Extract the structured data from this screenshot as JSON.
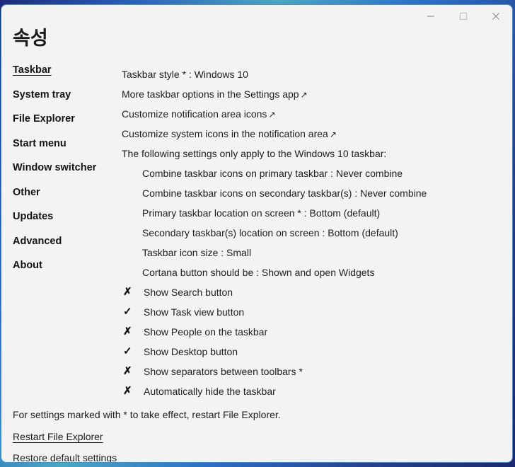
{
  "window": {
    "title": "속성",
    "border_color": "#3f8fdc",
    "background": "#f3f3f3",
    "controls": [
      {
        "name": "minimize",
        "glyph": "minimize-icon"
      },
      {
        "name": "maximize",
        "glyph": "maximize-icon"
      },
      {
        "name": "close",
        "glyph": "close-icon"
      }
    ]
  },
  "sidebar": {
    "items": [
      {
        "label": "Taskbar",
        "active": true
      },
      {
        "label": "System tray",
        "active": false
      },
      {
        "label": "File Explorer",
        "active": false
      },
      {
        "label": "Start menu",
        "active": false
      },
      {
        "label": "Window switcher",
        "active": false
      },
      {
        "label": "Other",
        "active": false
      },
      {
        "label": "Updates",
        "active": false
      },
      {
        "label": "Advanced",
        "active": false
      },
      {
        "label": "About",
        "active": false
      }
    ]
  },
  "content": {
    "rows": [
      {
        "text": "Taskbar style * : Windows 10",
        "indent": false,
        "external": false
      },
      {
        "text": "More taskbar options in the Settings app",
        "indent": false,
        "external": true
      },
      {
        "text": "Customize notification area icons",
        "indent": false,
        "external": true
      },
      {
        "text": "Customize system icons in the notification area",
        "indent": false,
        "external": true
      },
      {
        "text": "The following settings only apply to the Windows 10 taskbar:",
        "indent": false,
        "external": false
      },
      {
        "text": "Combine taskbar icons on primary taskbar : Never combine",
        "indent": true,
        "external": false
      },
      {
        "text": "Combine taskbar icons on secondary taskbar(s) : Never combine",
        "indent": true,
        "external": false
      },
      {
        "text": "Primary taskbar location on screen * : Bottom (default)",
        "indent": true,
        "external": false
      },
      {
        "text": "Secondary taskbar(s) location on screen : Bottom (default)",
        "indent": true,
        "external": false
      },
      {
        "text": "Taskbar icon size : Small",
        "indent": true,
        "external": false
      },
      {
        "text": "Cortana button should be : Shown and open Widgets",
        "indent": true,
        "external": false
      }
    ],
    "external_arrow": "↗",
    "checks": [
      {
        "label": "Show Search button",
        "checked": false
      },
      {
        "label": "Show Task view button",
        "checked": true
      },
      {
        "label": "Show People on the taskbar",
        "checked": false
      },
      {
        "label": "Show Desktop button",
        "checked": true
      },
      {
        "label": "Show separators between toolbars *",
        "checked": false
      },
      {
        "label": "Automatically hide the taskbar",
        "checked": false
      }
    ],
    "check_glyph_on": "✓",
    "check_glyph_off": "✗"
  },
  "footer": {
    "note": "For settings marked with * to take effect, restart File Explorer.",
    "links": [
      {
        "label": "Restart File Explorer"
      },
      {
        "label": "Restore default settings"
      }
    ]
  }
}
